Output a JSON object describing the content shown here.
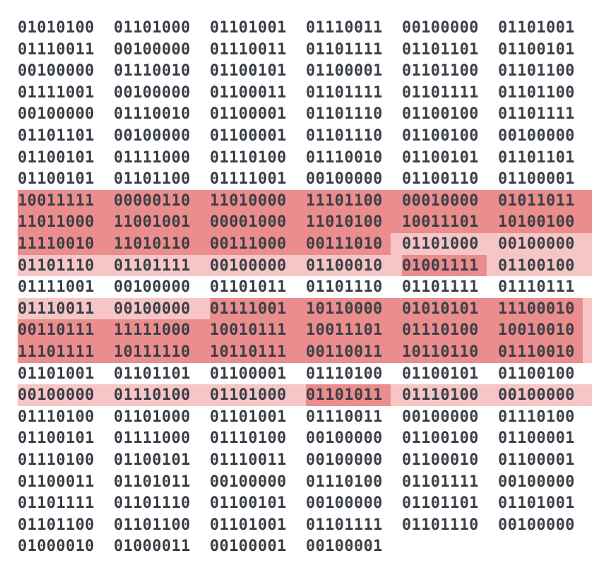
{
  "binary_rows": [
    [
      "01010100",
      "01101000",
      "01101001",
      "01110011",
      "00100000",
      "01101001"
    ],
    [
      "01110011",
      "00100000",
      "01110011",
      "01101111",
      "01101101",
      "01100101"
    ],
    [
      "00100000",
      "01110010",
      "01100101",
      "01100001",
      "01101100",
      "01101100"
    ],
    [
      "01111001",
      "00100000",
      "01100011",
      "01101111",
      "01101111",
      "01101100"
    ],
    [
      "00100000",
      "01110010",
      "01100001",
      "01101110",
      "01100100",
      "01101111"
    ],
    [
      "01101101",
      "00100000",
      "01100001",
      "01101110",
      "01100100",
      "00100000"
    ],
    [
      "01100101",
      "01111000",
      "01110100",
      "01110010",
      "01100101",
      "01101101"
    ],
    [
      "01100101",
      "01101100",
      "01111001",
      "00100000",
      "01100110",
      "01100001"
    ],
    [
      "10011111",
      "00000110",
      "11010000",
      "11101100",
      "00010000",
      "01011011"
    ],
    [
      "11011000",
      "11001001",
      "00001000",
      "11010100",
      "10011101",
      "10100100"
    ],
    [
      "11110010",
      "11010110",
      "00111000",
      "00111010",
      "01101000",
      "00100000"
    ],
    [
      "01101110",
      "01101111",
      "00100000",
      "01100010",
      "01001111",
      "01100100"
    ],
    [
      "01111001",
      "00100000",
      "01101011",
      "01101110",
      "01101111",
      "01110111"
    ],
    [
      "01110011",
      "00100000",
      "01111001",
      "10110000",
      "01010101",
      "11100010"
    ],
    [
      "00110111",
      "11111000",
      "10010111",
      "10011101",
      "01110100",
      "10010010"
    ],
    [
      "11101111",
      "10111110",
      "10110111",
      "00110011",
      "10110110",
      "01110010"
    ],
    [
      "01101001",
      "01101101",
      "01100001",
      "01110100",
      "01100101",
      "01100100"
    ],
    [
      "00100000",
      "01110100",
      "01101000",
      "01101011",
      "01110100",
      "00100000"
    ],
    [
      "01110100",
      "01101000",
      "01101001",
      "01110011",
      "00100000",
      "01110100"
    ],
    [
      "01100101",
      "01111000",
      "01110100",
      "00100000",
      "01100100",
      "01100001"
    ],
    [
      "01110100",
      "01100101",
      "01110011",
      "00100000",
      "01100010",
      "01100001"
    ],
    [
      "01100011",
      "01101011",
      "00100000",
      "01110100",
      "01101111",
      "00100000"
    ],
    [
      "01101111",
      "01101110",
      "01100101",
      "00100000",
      "01101101",
      "01101001"
    ],
    [
      "01101100",
      "01101100",
      "01101001",
      "01101111",
      "01101110",
      "00100000"
    ],
    [
      "01000010",
      "01000011",
      "00100001",
      "00100001"
    ]
  ],
  "colors": {
    "text": "#3a3f47",
    "highlight_light": "#f6c6c6",
    "highlight_dark": "#ec8d8d",
    "background": "#ffffff"
  }
}
